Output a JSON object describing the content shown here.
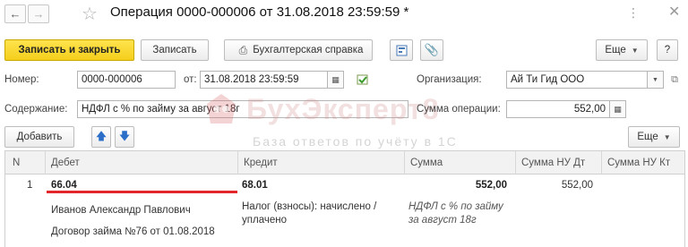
{
  "titlebar": {
    "title": "Операция 0000-000006 от 31.08.2018 23:59:59 *"
  },
  "toolbar": {
    "save_close_label": "Записать и закрыть",
    "save_label": "Записать",
    "report_label": "Бухгалтерская справка",
    "more_label": "Еще",
    "help_label": "?"
  },
  "form": {
    "number_label": "Номер:",
    "number_value": "0000-000006",
    "date_label": "от:",
    "date_value": "31.08.2018 23:59:59",
    "org_label": "Организация:",
    "org_value": "Ай Ти Гид ООО",
    "content_label": "Содержание:",
    "content_value": "НДФЛ с % по займу за август 18г",
    "sum_label": "Сумма операции:",
    "sum_value": "552,00"
  },
  "watermark": {
    "title": "БухЭксперт8",
    "subtitle": "База ответов по учёту в 1С"
  },
  "table_toolbar": {
    "add_label": "Добавить",
    "more_label": "Еще"
  },
  "table": {
    "columns": [
      "N",
      "Дебет",
      "Кредит",
      "Сумма",
      "Сумма НУ Дт",
      "Сумма НУ Кт"
    ],
    "rows": [
      {
        "n": "1",
        "debit": "66.04",
        "debit_sub1": "Иванов Александр Павлович",
        "debit_sub2": "Договор займа №76 от 01.08.2018",
        "credit": "68.01",
        "credit_sub1": "Налог (взносы): начислено /",
        "credit_sub2": "уплачено",
        "sum": "552,00",
        "sum_note1": "НДФЛ с % по займу",
        "sum_note2": "за август 18г",
        "sum_nu_dt": "552,00",
        "sum_nu_kt": ""
      }
    ]
  }
}
